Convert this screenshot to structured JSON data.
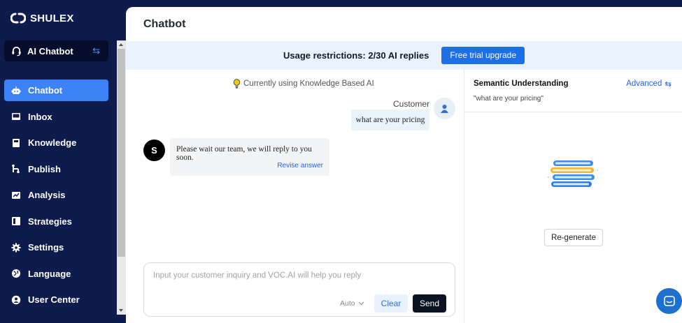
{
  "brand": {
    "name": "SHULEX"
  },
  "app_switch": {
    "label": "AI Chatbot"
  },
  "nav": {
    "items": [
      {
        "label": "Chatbot",
        "icon": "robot-icon",
        "active": true
      },
      {
        "label": "Inbox",
        "icon": "inbox-icon",
        "active": false
      },
      {
        "label": "Knowledge",
        "icon": "book-icon",
        "active": false
      },
      {
        "label": "Publish",
        "icon": "share-icon",
        "active": false
      },
      {
        "label": "Analysis",
        "icon": "chart-icon",
        "active": false
      },
      {
        "label": "Strategies",
        "icon": "strategy-icon",
        "active": false
      },
      {
        "label": "Settings",
        "icon": "gear-icon",
        "active": false
      },
      {
        "label": "Language",
        "icon": "globe-icon",
        "active": false
      },
      {
        "label": "User Center",
        "icon": "user-icon",
        "active": false
      }
    ]
  },
  "main": {
    "title": "Chatbot",
    "banner": {
      "text": "Usage restrictions: 2/30 AI replies",
      "button": "Free trial upgrade"
    },
    "chat": {
      "ai_note": "Currently using Knowledge Based AI",
      "customer_name": "Customer",
      "customer_message": "what are your pricing",
      "bot_initial": "S",
      "bot_message": "Please wait our team, we will reply to you soon.",
      "revise_label": "Revise answer"
    },
    "composer": {
      "placeholder": "Input your customer inquiry and VOC.AI will help you reply",
      "mode": "Auto",
      "clear_label": "Clear",
      "send_label": "Send"
    },
    "semantic": {
      "title": "Semantic Understanding",
      "advanced_label": "Advanced",
      "query": "\"what are your pricing\"",
      "regenerate_label": "Re-generate"
    }
  },
  "colors": {
    "sidebar_bg": "#0e1b4d",
    "accent": "#3b82f6",
    "banner_bg": "#eaf3fd",
    "send_bg": "#0b1220"
  }
}
